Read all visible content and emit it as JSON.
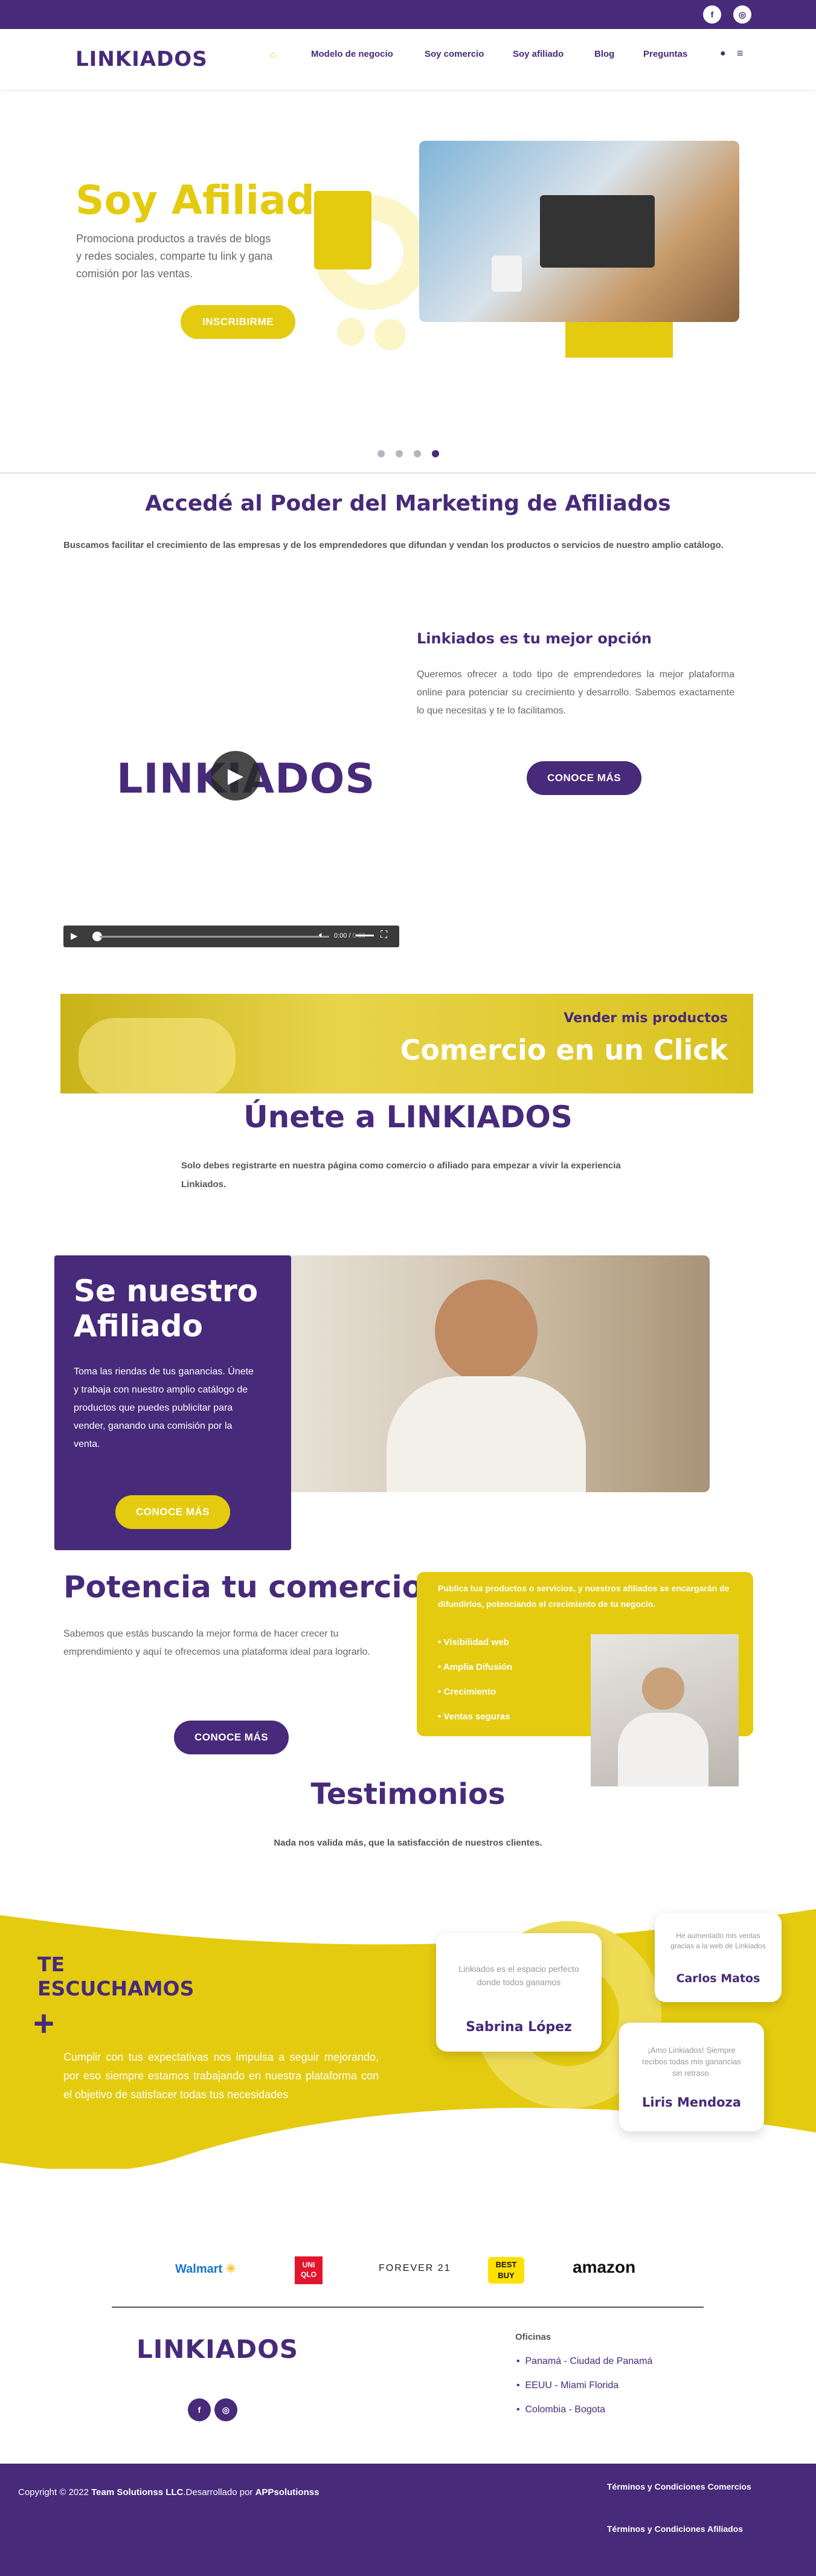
{
  "brand": {
    "logo_text": "LINKIADOS",
    "colors": {
      "purple": "#472a7a",
      "yellow": "#e4cb10"
    }
  },
  "topbar": {
    "icons": [
      "facebook-icon",
      "instagram-icon"
    ]
  },
  "nav": {
    "home_icon": "home-icon",
    "items": [
      "Modelo de negocio",
      "Soy comercio",
      "Soy afiliado",
      "Blog",
      "Preguntas"
    ],
    "user_icon": "user-icon",
    "menu_icon": "menu-icon"
  },
  "hero": {
    "title": "Soy Afiliado",
    "text": "Promociona productos a través de blogs y redes sociales, comparte tu link y gana comisión por las ventas.",
    "button": "INSCRIBIRME",
    "slides": 4,
    "active_slide": 4
  },
  "intro": {
    "title": "Accedé al Poder del Marketing de Afiliados",
    "text": "Buscamos facilitar el crecimiento de las empresas y de los emprendedores que difundan y vendan los productos o servicios de nuestro amplio catálogo."
  },
  "best": {
    "title": "Linkiados es tu mejor opción",
    "text": "Queremos ofrecer a todo tipo de emprendedores la mejor plataforma online para potenciar su crecimiento y desarrollo. Sabemos exactamente lo que necesitas y te lo facilitamos.",
    "button": "CONOCE MÁS"
  },
  "audio": {
    "time": "0:00",
    "separator": "/",
    "duration": "0:00"
  },
  "banner": {
    "subtitle": "Vender mis productos",
    "title": "Comercio en un Click"
  },
  "join": {
    "title": "Únete a LINKIADOS",
    "text": "Solo debes registrarte en nuestra página como comercio o afiliado para empezar a vivir la experiencia Linkiados."
  },
  "affiliate": {
    "title": "Se nuestro Afiliado",
    "text": "Toma las riendas de tus ganancias. Únete y trabaja con nuestro amplio catálogo de productos que puedes publicitar para vender, ganando una comisión por la venta.",
    "button": "CONOCE MÁS"
  },
  "boost": {
    "title": "Potencia tu comercio",
    "text": "Sabemos que estás buscando la mejor forma de hacer crecer tu emprendimiento y aquí te ofrecemos una plataforma ideal para lograrlo.",
    "button": "CONOCE MÁS",
    "card_text": "Publica tus productos o servicios, y nuestros afiliados se encargarán de difundirlos, potenciando el crecimiento de tu negocio.",
    "bullets": [
      "Visibilidad web",
      "Amplia Difusión",
      "Crecimiento",
      "Ventas seguras"
    ]
  },
  "testimonials": {
    "title": "Testimonios",
    "subtitle": "Nada nos valida más, que la satisfacción de nuestros clientes.",
    "listen_title": "TE ESCUCHAMOS",
    "listen_text": "Cumplir con tus expectativas nos impulsa a seguir mejorando, por eso siempre estamos trabajando en nuestra plataforma con el objetivo de satisfacer todas tus necesidades",
    "cards": [
      {
        "quote": "Linkiados es el espacio perfecto donde todos ganamos",
        "name": "Sabrina López"
      },
      {
        "quote": "He aumentado mis ventas gracias a la web de Linkiados",
        "name": "Carlos Matos"
      },
      {
        "quote": "¡Amo Linkiados! Siempre recibos todas mis ganancias sin retraso.",
        "name": "Liris Mendoza"
      }
    ]
  },
  "partners": [
    "Walmart",
    "UNI QLO",
    "FOREVER 21",
    "BEST BUY",
    "amazon"
  ],
  "footer": {
    "offices_title": "Oficinas",
    "offices": [
      "Panamá - Ciudad de Panamá",
      "EEUU - Miami Florida",
      "Colombia - Bogota"
    ],
    "copyright_prefix": "Copyright © 2022",
    "company": "Team Solutionss LLC",
    "developed": ".Desarrollado por",
    "developer": "APPsolutionss",
    "link_1": "Términos y Condiciones Comercios",
    "link_2": "Términos y Condiciones Afiliados"
  }
}
